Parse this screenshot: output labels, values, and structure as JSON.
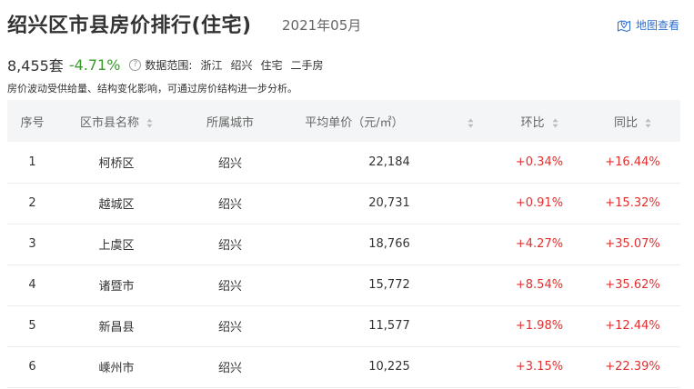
{
  "header": {
    "title": "绍兴区市县房价排行(住宅)",
    "date": "2021年05月",
    "map_link_label": "地图查看"
  },
  "summary": {
    "count": "8,455套",
    "change": "-4.71%",
    "scope_label": "数据范围:",
    "scope_tags": [
      "浙江",
      "绍兴",
      "住宅",
      "二手房"
    ],
    "note": "房价波动受供给量、结构变化影响，可通过房价结构进一步分析。"
  },
  "table": {
    "columns": [
      "序号",
      "区市县名称",
      "所属城市",
      "平均单价（元/㎡）",
      "环比",
      "同比"
    ],
    "rows": [
      {
        "index": "1",
        "district": "柯桥区",
        "city": "绍兴",
        "price": "22,184",
        "mom": "+0.34%",
        "yoy": "+16.44%"
      },
      {
        "index": "2",
        "district": "越城区",
        "city": "绍兴",
        "price": "20,731",
        "mom": "+0.91%",
        "yoy": "+15.32%"
      },
      {
        "index": "3",
        "district": "上虞区",
        "city": "绍兴",
        "price": "18,766",
        "mom": "+4.27%",
        "yoy": "+35.07%"
      },
      {
        "index": "4",
        "district": "诸暨市",
        "city": "绍兴",
        "price": "15,772",
        "mom": "+8.54%",
        "yoy": "+35.62%"
      },
      {
        "index": "5",
        "district": "新昌县",
        "city": "绍兴",
        "price": "11,577",
        "mom": "+1.98%",
        "yoy": "+12.44%"
      },
      {
        "index": "6",
        "district": "嵊州市",
        "city": "绍兴",
        "price": "10,225",
        "mom": "+3.15%",
        "yoy": "+22.39%"
      }
    ]
  },
  "colors": {
    "positive": "#e03030",
    "negative": "#3a9a2c",
    "link": "#2f6fcf",
    "header_bg": "#f4f5f7"
  },
  "icons": {
    "map_link": "map-pin-icon",
    "help": "question-circle-icon",
    "sort": "sort-icon"
  }
}
